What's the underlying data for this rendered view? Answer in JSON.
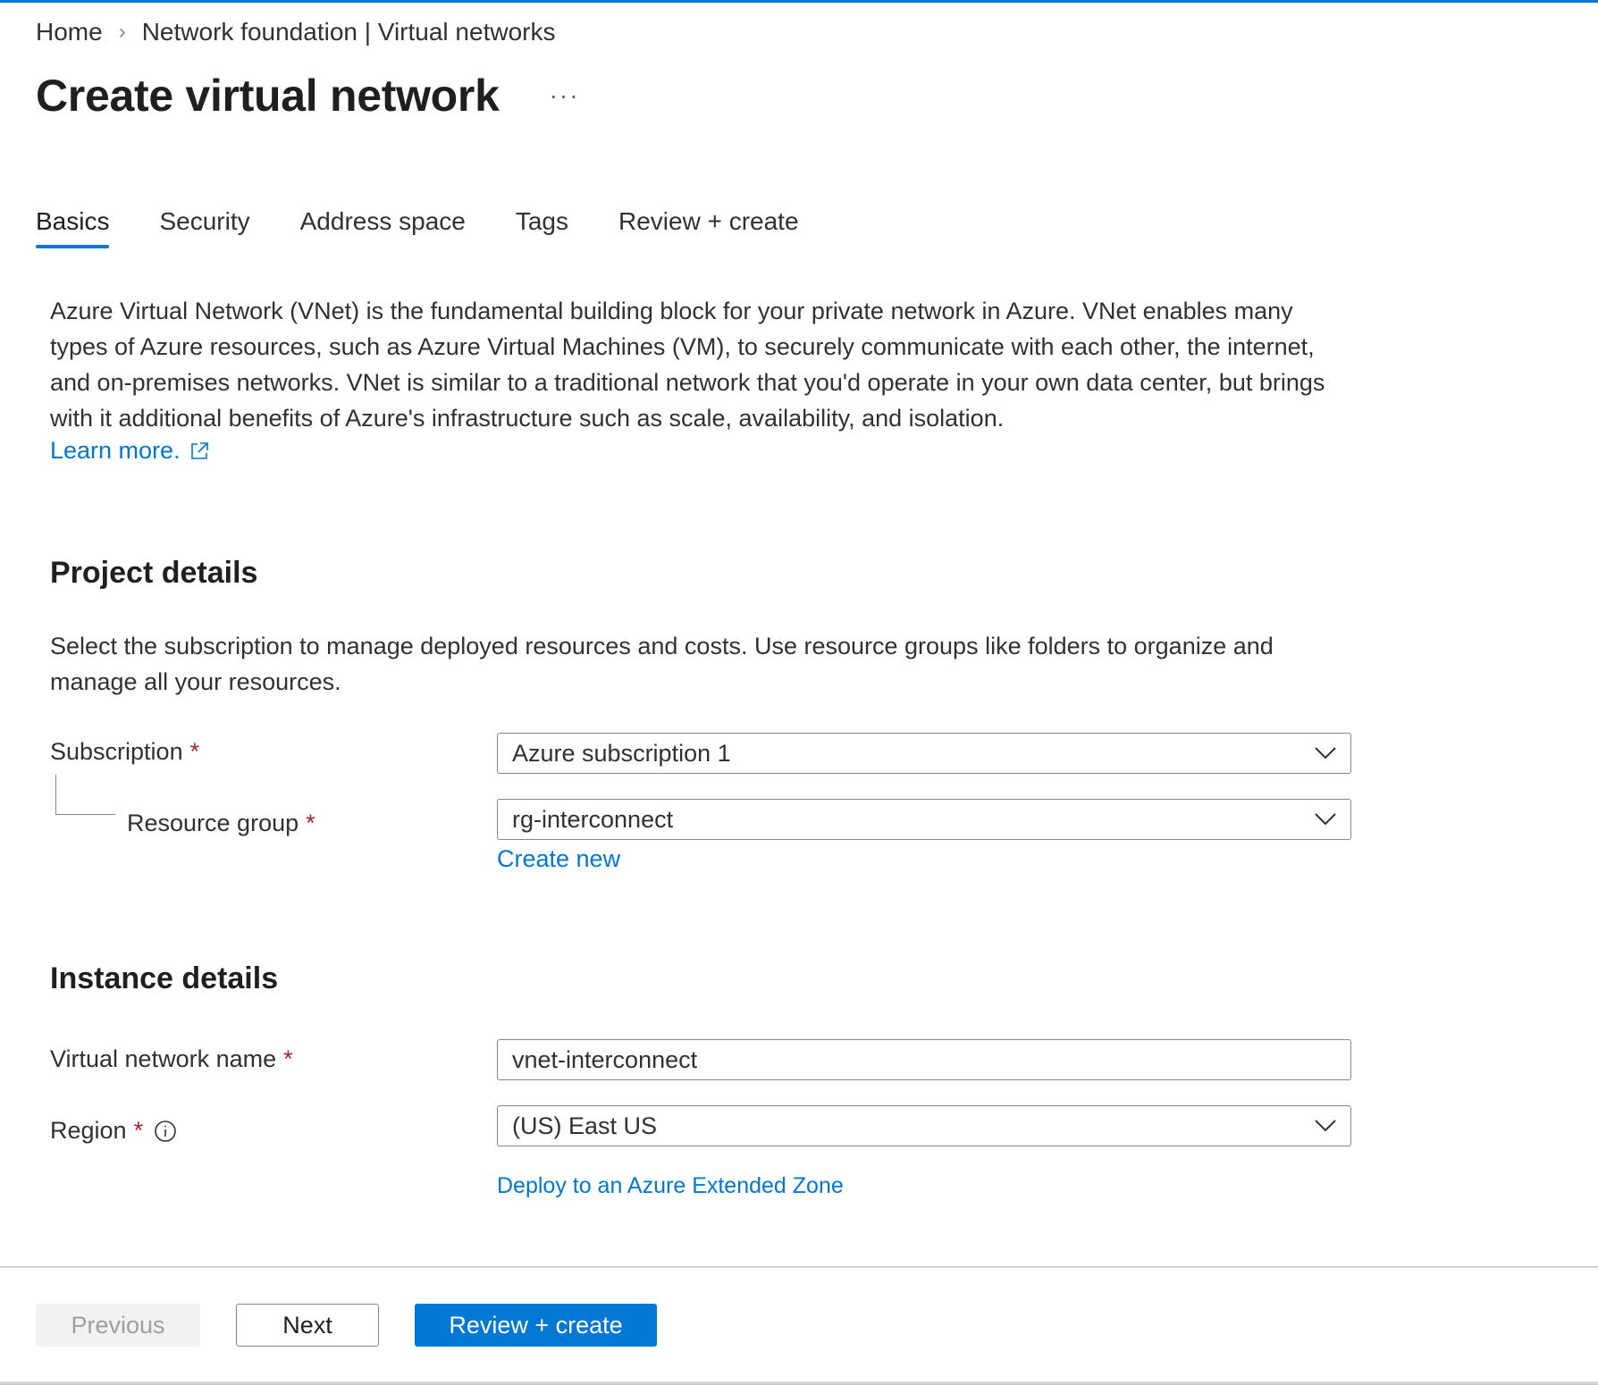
{
  "breadcrumb": {
    "home": "Home",
    "parent": "Network foundation | Virtual networks",
    "separator": "›"
  },
  "header": {
    "title": "Create virtual network",
    "more": "···"
  },
  "tabs": [
    {
      "label": "Basics",
      "active": true
    },
    {
      "label": "Security",
      "active": false
    },
    {
      "label": "Address space",
      "active": false
    },
    {
      "label": "Tags",
      "active": false
    },
    {
      "label": "Review + create",
      "active": false
    }
  ],
  "intro": {
    "text": "Azure Virtual Network (VNet) is the fundamental building block for your private network in Azure. VNet enables many types of Azure resources, such as Azure Virtual Machines (VM), to securely communicate with each other, the internet, and on-premises networks. VNet is similar to a traditional network that you'd operate in your own data center, but brings with it additional benefits of Azure's infrastructure such as scale, availability, and isolation.",
    "learn_more": "Learn more.",
    "learn_more_icon": "external-link-icon"
  },
  "project_details": {
    "heading": "Project details",
    "description": "Select the subscription to manage deployed resources and costs. Use resource groups like folders to organize and manage all your resources.",
    "subscription": {
      "label": "Subscription",
      "required": "*",
      "value": "Azure subscription 1"
    },
    "resource_group": {
      "label": "Resource group",
      "required": "*",
      "value": "rg-interconnect",
      "create_new": "Create new"
    }
  },
  "instance_details": {
    "heading": "Instance details",
    "vnet_name": {
      "label": "Virtual network name",
      "required": "*",
      "value": "vnet-interconnect"
    },
    "region": {
      "label": "Region",
      "required": "*",
      "info_icon": "info-icon",
      "value": "(US) East US",
      "extended_zone": "Deploy to an Azure Extended Zone"
    }
  },
  "footer": {
    "previous": "Previous",
    "next": "Next",
    "review_create": "Review + create"
  },
  "colors": {
    "accent": "#0078d4",
    "required": "#a4262c",
    "text": "#323130",
    "disabled_text": "#a19f9d"
  }
}
